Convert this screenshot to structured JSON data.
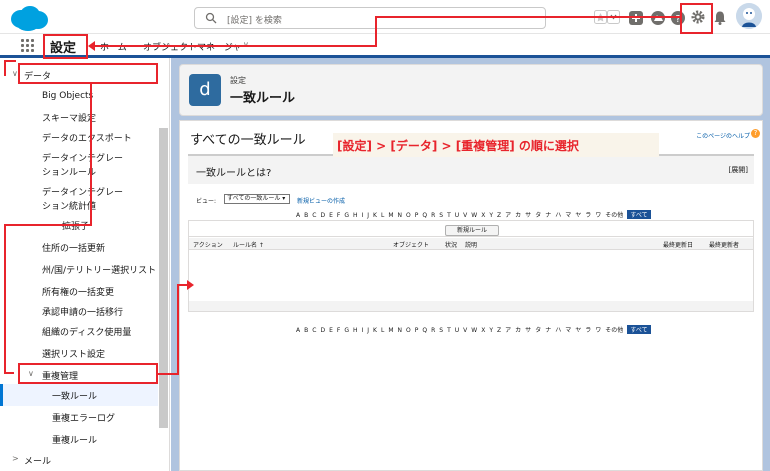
{
  "header": {
    "search_placeholder": "[設定] を検索",
    "icons": [
      "cloud-logo",
      "search-icon",
      "add-icon",
      "help-icon",
      "gear-icon",
      "bell-icon",
      "avatar"
    ]
  },
  "nav": {
    "app_name": "設定",
    "tabs": [
      {
        "label": "ホーム"
      },
      {
        "label": "オブジェクトマネージャー"
      }
    ]
  },
  "sidebar": {
    "items": [
      {
        "label": "データ",
        "caret": "∨"
      },
      {
        "label": "Big Objects"
      },
      {
        "label": "スキーマ設定"
      },
      {
        "label": "データのエクスポート"
      },
      {
        "label": "データインテグレーションルール"
      },
      {
        "label": "データインテグレーション統計値"
      },
      {
        "label": "拡張子"
      },
      {
        "label": "住所の一括更新"
      },
      {
        "label": "州/国/テリトリー選択リスト"
      },
      {
        "label": "所有権の一括変更"
      },
      {
        "label": "承認申請の一括移行"
      },
      {
        "label": "組織のディスク使用量"
      },
      {
        "label": "選択リスト設定"
      },
      {
        "label": "重複管理",
        "caret": "∨"
      },
      {
        "label": "一致ルール"
      },
      {
        "label": "重複エラーログ"
      },
      {
        "label": "重複ルール"
      },
      {
        "label": "メール",
        "caret": ">"
      }
    ]
  },
  "page_header": {
    "icon_letter": "d",
    "breadcrumb": "設定",
    "title": "一致ルール"
  },
  "content": {
    "title": "すべての一致ルール",
    "help_link": "このページのヘルプ",
    "help_icon": "?",
    "annotation": "[設定] > [データ] > [重複管理] の順に選択",
    "info_title": "一致ルールとは?",
    "info_expand": "[展開]",
    "view_label": "ビュー:",
    "view_value": "すべての一致ルール",
    "view_new_link": "新規ビューの作成",
    "alphabet": [
      "A",
      "B",
      "C",
      "D",
      "E",
      "F",
      "G",
      "H",
      "I",
      "J",
      "K",
      "L",
      "M",
      "N",
      "O",
      "P",
      "Q",
      "R",
      "S",
      "T",
      "U",
      "V",
      "W",
      "X",
      "Y",
      "Z",
      "ア",
      "カ",
      "サ",
      "タ",
      "ナ",
      "ハ",
      "マ",
      "ヤ",
      "ラ",
      "ワ",
      "その他",
      "すべて"
    ],
    "new_rule_button": "新規ルール",
    "columns": [
      "アクション",
      "ルール名 ↑",
      "オブジェクト",
      "状況",
      "説明",
      "最終更新日",
      "最終更新者"
    ]
  },
  "colors": {
    "accent": "#1b5297",
    "annotation_red": "#e8242c",
    "main_bg": "#b0c4df",
    "object_icon": "#2e6b9f"
  }
}
